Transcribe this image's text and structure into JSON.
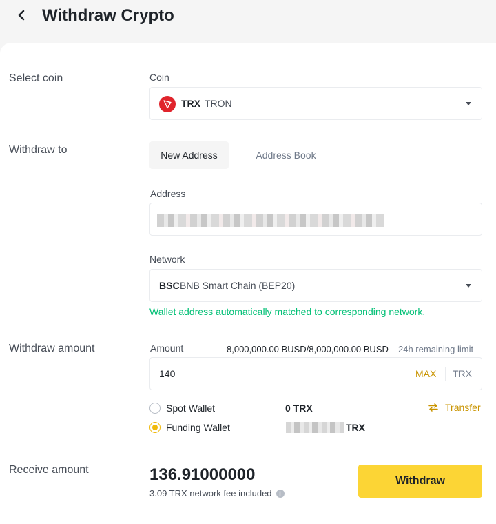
{
  "header": {
    "title": "Withdraw Crypto"
  },
  "sections": {
    "select_coin": "Select coin",
    "withdraw_to": "Withdraw to",
    "withdraw_amount": "Withdraw amount",
    "receive_amount": "Receive amount"
  },
  "coin": {
    "label": "Coin",
    "symbol": "TRX",
    "name": "TRON",
    "icon": "tron-logo-icon",
    "icon_color": "#e0242c"
  },
  "tabs": {
    "new_address": "New Address",
    "address_book": "Address Book"
  },
  "address": {
    "label": "Address"
  },
  "network": {
    "label": "Network",
    "code": "BSC",
    "name": "BNB Smart Chain (BEP20)",
    "hint": "Wallet address automatically matched to corresponding network."
  },
  "amount": {
    "label": "Amount",
    "limit_value": "8,000,000.00 BUSD/8,000,000.00 BUSD",
    "limit_label": "24h remaining limit",
    "value": "140",
    "max": "MAX",
    "unit": "TRX"
  },
  "wallets": {
    "spot_label": "Spot Wallet",
    "spot_balance": "0 TRX",
    "funding_label": "Funding Wallet",
    "funding_unit": "TRX",
    "selected": "funding",
    "transfer": "Transfer"
  },
  "receive": {
    "value": "136.91000000",
    "fee_text": "3.09 TRX network fee included"
  },
  "actions": {
    "withdraw": "Withdraw"
  },
  "colors": {
    "accent": "#f0b90b",
    "button": "#fcd535",
    "link_gold": "#c99400",
    "success": "#02c076"
  }
}
